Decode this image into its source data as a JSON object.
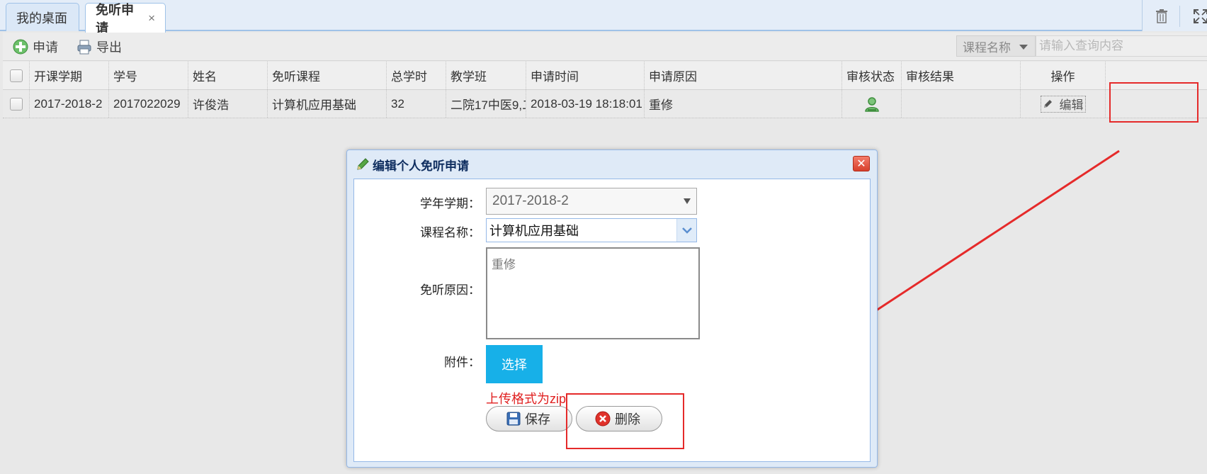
{
  "tabs": [
    {
      "label": "我的桌面"
    },
    {
      "label": "免听申请",
      "close": "×"
    }
  ],
  "toolbar": {
    "apply_label": "申请",
    "export_label": "导出",
    "search_field": "课程名称",
    "search_placeholder": "请输入查询内容"
  },
  "table": {
    "columns": [
      "开课学期",
      "学号",
      "姓名",
      "免听课程",
      "总学时",
      "教学班",
      "申请时间",
      "申请原因",
      "审核状态",
      "审核结果",
      "操作"
    ],
    "rows": [
      {
        "term": "2017-2018-2",
        "student_id": "2017022029",
        "name": "许俊浩",
        "course": "计算机应用基础",
        "hours": "32",
        "class": "二院17中医9,二",
        "apply_time": "2018-03-19 18:18:01",
        "reason": "重修",
        "review_result": "",
        "action": "编辑"
      }
    ]
  },
  "dialog": {
    "title": "编辑个人免听申请",
    "term_label": "学年学期：",
    "term_value": "2017-2018-2",
    "course_label": "课程名称：",
    "course_value": "计算机应用基础",
    "reason_label": "免听原因：",
    "reason_value": "重修",
    "attach_label": "附件：",
    "choose_label": "选择",
    "hint": "上传格式为zip",
    "save_label": "保存",
    "delete_label": "删除"
  },
  "colors": {
    "highlight": "#e52a2a",
    "choose_button": "#17b0e8",
    "hint": "#e02020",
    "dialog_border": "#95b8e7"
  }
}
